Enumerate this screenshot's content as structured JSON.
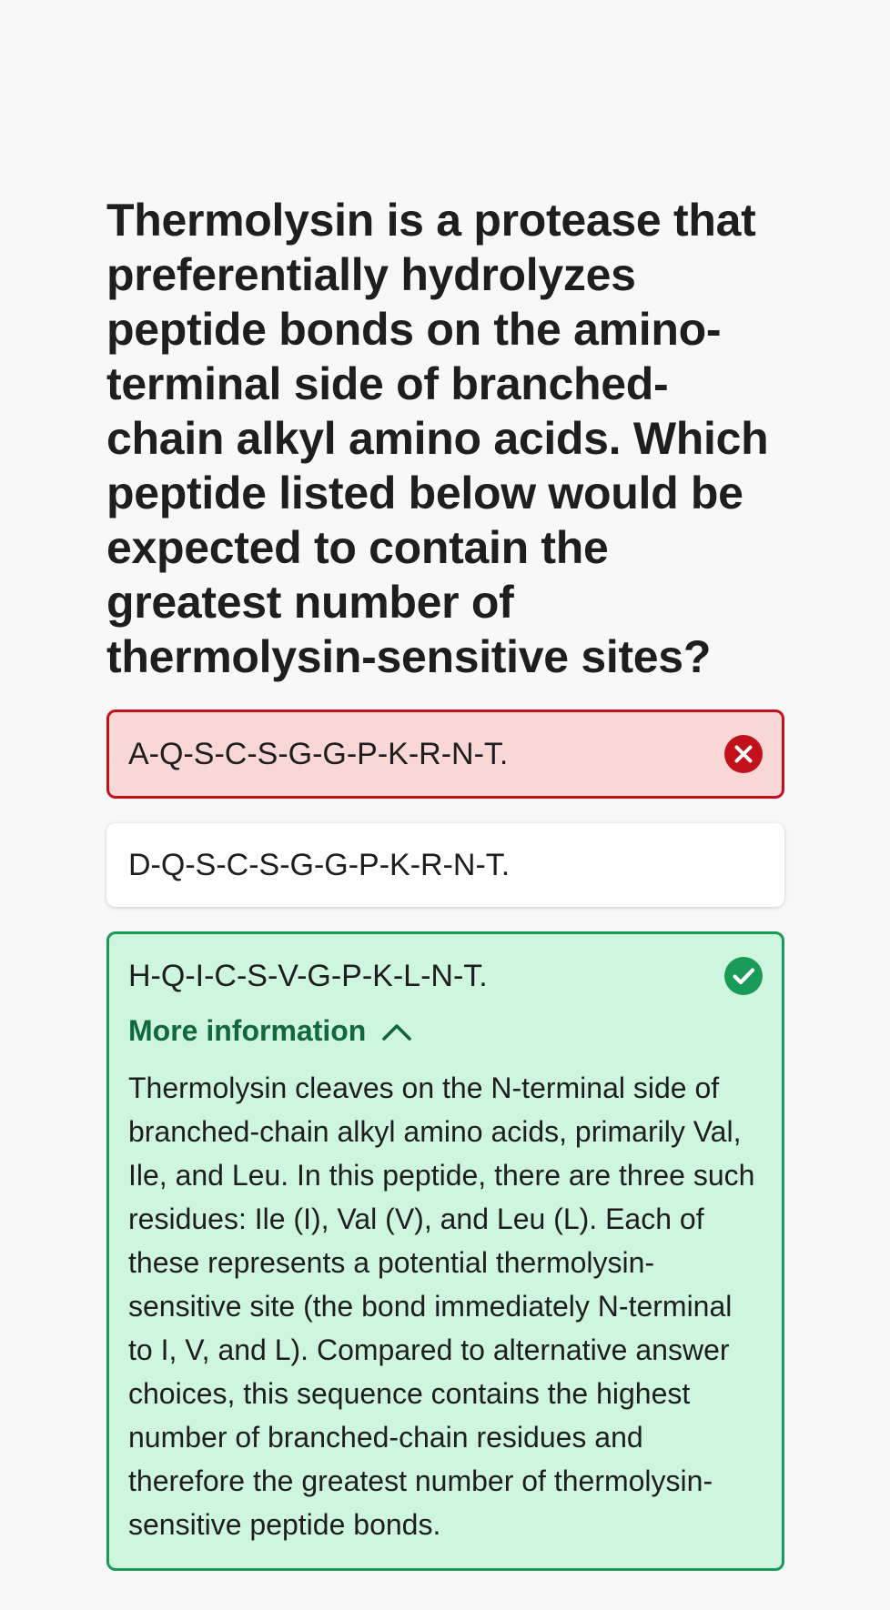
{
  "question": {
    "text": "Thermolysin is a protease that preferentially hydrolyzes peptide bonds on the amino-terminal side of branched-chain alkyl amino acids. Which peptide listed below would be expected to contain the greatest number of thermolysin-sensitive sites?"
  },
  "options": [
    {
      "label": "A-Q-S-C-S-G-G-P-K-R-N-T.",
      "state": "wrong",
      "icon": "x-circle-icon"
    },
    {
      "label": "D-Q-S-C-S-G-G-P-K-R-N-T.",
      "state": "neutral"
    },
    {
      "label": "H-Q-I-C-S-V-G-P-K-L-N-T.",
      "state": "correct",
      "icon": "check-circle-icon"
    }
  ],
  "more_info": {
    "label": "More information",
    "expanded": true,
    "icon": "chevron-up-icon",
    "text": "Thermolysin cleaves on the N-terminal side of branched-chain alkyl amino acids, primarily Val, Ile, and Leu. In this peptide, there are three such residues: Ile (I), Val (V), and Leu (L). Each of these represents a potential thermolysin-sensitive site (the bond immediately N-terminal to I, V, and L). Compared to alternative answer choices, this sequence contains the highest number of branched-chain residues and therefore the greatest number of thermolysin-sensitive peptide bonds."
  },
  "colors": {
    "page_background": "#f8f8f8",
    "wrong_border": "#c1111b",
    "wrong_background": "#fad7d7",
    "correct_border": "#1a9a57",
    "correct_background": "#cef6df",
    "correct_text": "#11683a"
  }
}
